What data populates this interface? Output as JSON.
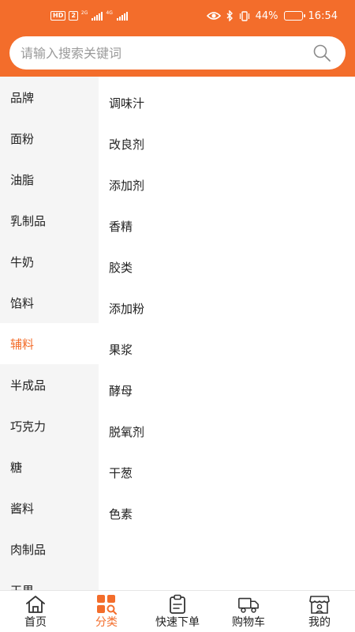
{
  "status_bar": {
    "hd_label": "HD",
    "sim_label": "2",
    "net1": "2G",
    "net2": "4G",
    "battery_percent_text": "44%",
    "battery_level": 0.44,
    "time": "16:54"
  },
  "search": {
    "placeholder": "请输入搜索关键词"
  },
  "sidebar": {
    "active_index": 6,
    "items": [
      {
        "label": "品牌"
      },
      {
        "label": "面粉"
      },
      {
        "label": "油脂"
      },
      {
        "label": "乳制品"
      },
      {
        "label": "牛奶"
      },
      {
        "label": "馅料"
      },
      {
        "label": "辅料"
      },
      {
        "label": "半成品"
      },
      {
        "label": "巧克力"
      },
      {
        "label": "糖"
      },
      {
        "label": "酱料"
      },
      {
        "label": "肉制品"
      },
      {
        "label": "干果"
      }
    ]
  },
  "content": {
    "items": [
      {
        "label": "调味汁"
      },
      {
        "label": "改良剂"
      },
      {
        "label": "添加剂"
      },
      {
        "label": "香精"
      },
      {
        "label": "胶类"
      },
      {
        "label": "添加粉"
      },
      {
        "label": "果浆"
      },
      {
        "label": "酵母"
      },
      {
        "label": "脱氧剂"
      },
      {
        "label": "干葱"
      },
      {
        "label": "色素"
      }
    ]
  },
  "bottom_nav": {
    "accent": "#f36d2b",
    "items": [
      {
        "label": "首页",
        "icon": "home-icon"
      },
      {
        "label": "分类",
        "icon": "category-icon",
        "active": true
      },
      {
        "label": "快速下单",
        "icon": "clipboard-icon"
      },
      {
        "label": "购物车",
        "icon": "truck-icon"
      },
      {
        "label": "我的",
        "icon": "store-user-icon"
      }
    ]
  },
  "colors": {
    "brand": "#f36d2b",
    "sidebar_bg": "#f5f5f5",
    "text": "#222222"
  }
}
